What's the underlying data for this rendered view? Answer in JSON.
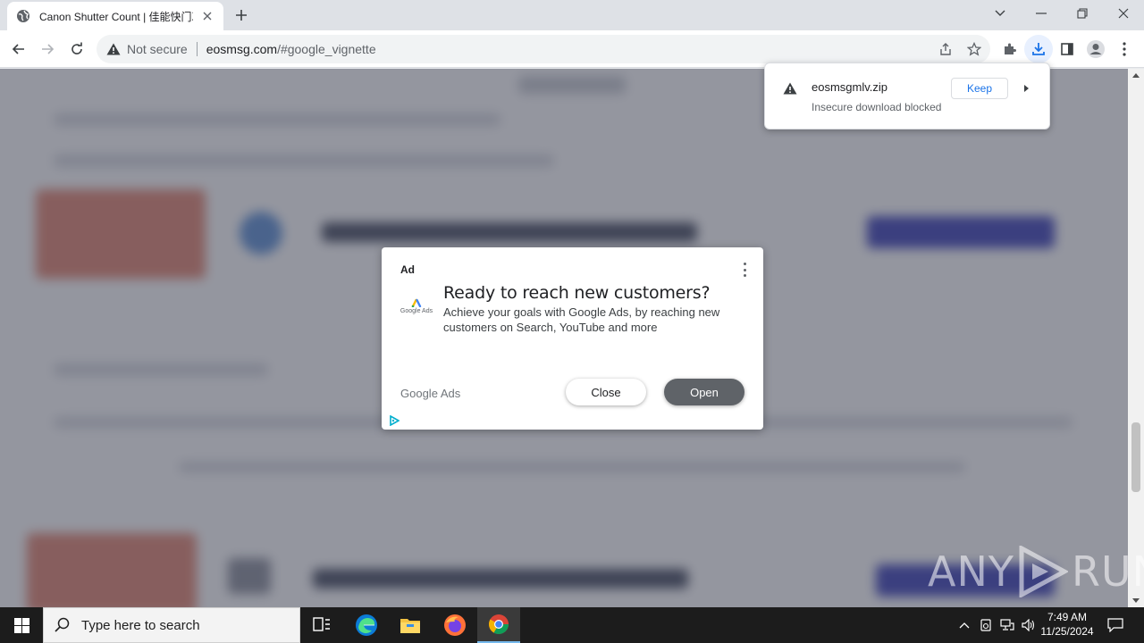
{
  "browser": {
    "tab": {
      "title": "Canon Shutter Count | 佳能快门次数",
      "close_icon": "close-icon",
      "favicon": "globe-icon"
    },
    "new_tab_icon": "plus-icon",
    "window_controls": [
      "chevron-down-icon",
      "minimize-icon",
      "restore-icon",
      "close-icon"
    ],
    "toolbar": {
      "security_label": "Not secure",
      "url_host": "eosmsg.com",
      "url_path": "/#google_vignette",
      "icons": [
        "back-icon",
        "forward-icon",
        "reload-icon",
        "share-icon",
        "star-icon",
        "extensions-icon",
        "download-icon",
        "side-panel-icon",
        "profile-icon",
        "kebab-menu-icon"
      ]
    }
  },
  "download_bubble": {
    "filename": "eosmsgmlv.zip",
    "status": "Insecure download blocked",
    "keep_label": "Keep"
  },
  "ad": {
    "label": "Ad",
    "logo_text": "Google Ads",
    "headline": "Ready to reach new customers?",
    "description": "Achieve your goals with Google Ads, by reaching new customers on Search, YouTube and more",
    "advertiser": "Google Ads",
    "close_label": "Close",
    "open_label": "Open"
  },
  "watermark": {
    "left": "ANY",
    "right": "RUN"
  },
  "taskbar": {
    "search_placeholder": "Type here to search",
    "time": "7:49 AM",
    "date": "11/25/2024"
  },
  "colors": {
    "accent_blue": "#1a73e8",
    "overlay": "#3c4050",
    "taskbar": "#1c1c1c"
  }
}
